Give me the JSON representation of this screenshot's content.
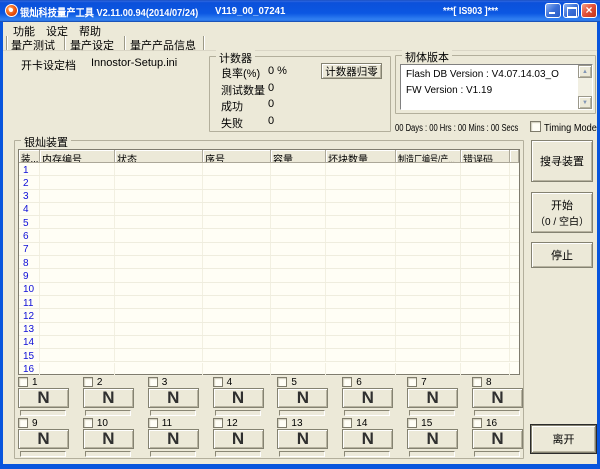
{
  "window": {
    "title_left": "银灿科技量产工具  V2.11.00.94(2014/07/24)",
    "title_mid": "V119_00_07241",
    "title_right": "***[ IS903 ]***"
  },
  "menu": {
    "items": [
      "功能",
      "设定",
      "帮助"
    ]
  },
  "tabs": {
    "items": [
      "量产测试",
      "量产设定",
      "量产产品信息"
    ],
    "selected": "量产测试"
  },
  "settings": {
    "label": "开卡设定档",
    "value": "Innostor-Setup.ini"
  },
  "counter": {
    "title": "计数器",
    "reset_button": "计数器归零",
    "rows": [
      {
        "label": "良率(%)",
        "value": "0 %"
      },
      {
        "label": "测试数量",
        "value": "0"
      },
      {
        "label": "成功",
        "value": "0"
      },
      {
        "label": "失败",
        "value": "0"
      }
    ]
  },
  "firmware": {
    "title": "韧体版本",
    "lines": [
      "Flash DB Version :  V4.07.14.03_O",
      "FW Version :   V1.19"
    ]
  },
  "timer": {
    "text": "00 Days : 00 Hrs : 00 Mins : 00 Secs",
    "timing_mode_label": "Timing Mode",
    "timing_mode_checked": false
  },
  "devices": {
    "title": "银灿装置",
    "columns": [
      "装...",
      "内存编号",
      "状态",
      "序号",
      "容量",
      "坏块数量",
      "制造厂编号/产...",
      "错误码"
    ],
    "rows": [
      "1",
      "2",
      "3",
      "4",
      "5",
      "6",
      "7",
      "8",
      "9",
      "10",
      "11",
      "12",
      "13",
      "14",
      "15",
      "16"
    ]
  },
  "actions": {
    "search": "搜寻装置",
    "start_line1": "开始",
    "start_line2": "（0 / 空白）",
    "stop": "停止",
    "exit": "离开"
  },
  "ports": {
    "status_letter": "N",
    "slots": [
      1,
      2,
      3,
      4,
      5,
      6,
      7,
      8,
      9,
      10,
      11,
      12,
      13,
      14,
      15,
      16
    ],
    "checked": false
  }
}
